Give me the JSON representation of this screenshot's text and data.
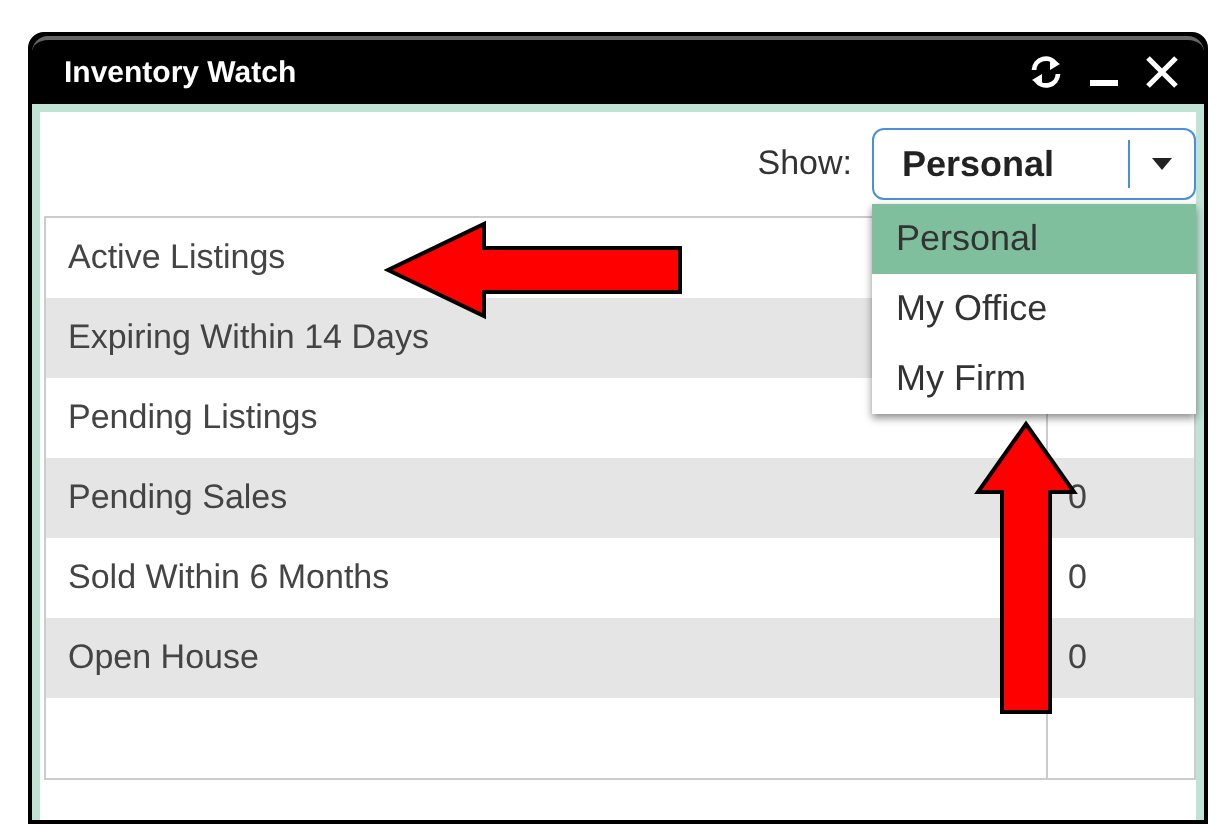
{
  "window": {
    "title": "Inventory Watch"
  },
  "show": {
    "label": "Show:",
    "value": "Personal",
    "options": [
      {
        "label": "Personal",
        "selected": true
      },
      {
        "label": "My Office",
        "selected": false
      },
      {
        "label": "My Firm",
        "selected": false
      }
    ]
  },
  "rows": [
    {
      "label": "Active Listings"
    },
    {
      "label": "Expiring Within 14 Days"
    },
    {
      "label": "Pending Listings"
    },
    {
      "label": "Pending Sales",
      "count": "0"
    },
    {
      "label": "Sold Within 6 Months",
      "count": "0"
    },
    {
      "label": "Open House",
      "count": "0"
    }
  ]
}
